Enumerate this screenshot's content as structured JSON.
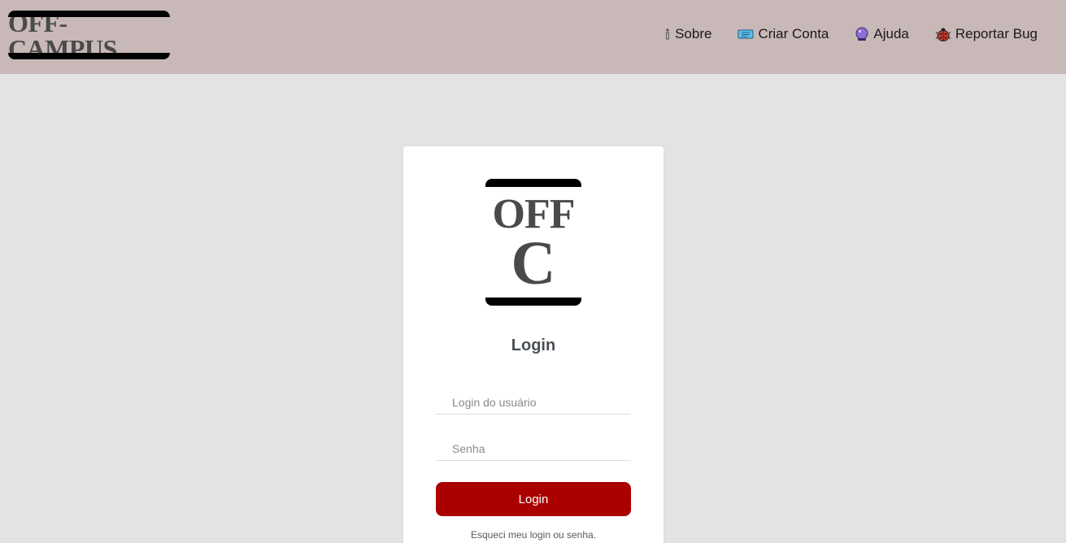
{
  "header": {
    "brand": "OFF-CAMPUS",
    "nav": [
      {
        "label": "Sobre",
        "icon": "info-icon"
      },
      {
        "label": "Criar Conta",
        "icon": "ticket-icon"
      },
      {
        "label": "Ajuda",
        "icon": "crystal-ball-icon"
      },
      {
        "label": "Reportar Bug",
        "icon": "ladybug-icon"
      }
    ]
  },
  "login": {
    "logo_line1": "OFF",
    "logo_line2": "C",
    "title": "Login",
    "username_placeholder": "Login do usuário",
    "password_placeholder": "Senha",
    "button_label": "Login",
    "forgot_link": "Esqueci meu login ou senha."
  },
  "colors": {
    "navbar": "#c8b8b7",
    "background": "#e3e3e3",
    "primary_button": "#aa0000"
  }
}
